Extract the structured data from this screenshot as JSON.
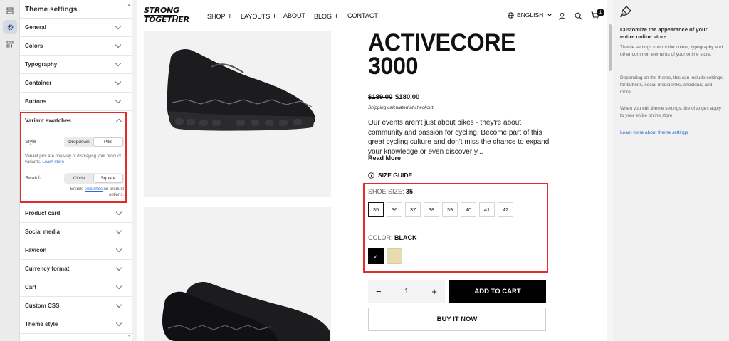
{
  "panel": {
    "title": "Theme settings",
    "sections_top": [
      {
        "label": "General"
      },
      {
        "label": "Colors"
      },
      {
        "label": "Typography"
      },
      {
        "label": "Container"
      },
      {
        "label": "Buttons"
      }
    ],
    "variant_swatches": {
      "label": "Variant swatches",
      "style_label": "Style",
      "style_options": [
        "Dropdown",
        "Pills"
      ],
      "style_selected": "Pills",
      "help_text": "Variant pills are one way of displaying your product variants.",
      "help_link": "Learn more",
      "swatch_label": "Swatch",
      "swatch_options": [
        "Circle",
        "Square"
      ],
      "swatch_selected": "Square",
      "note_prefix": "Enable",
      "note_link": "swatches",
      "note_suffix": "on product options."
    },
    "sections_bottom": [
      {
        "label": "Product card"
      },
      {
        "label": "Social media"
      },
      {
        "label": "Favicon"
      },
      {
        "label": "Currency format"
      },
      {
        "label": "Cart"
      },
      {
        "label": "Custom CSS"
      },
      {
        "label": "Theme style"
      }
    ]
  },
  "store": {
    "logo_line1": "STRONG",
    "logo_line2": "TOGETHER",
    "menu": [
      {
        "label": "SHOP",
        "has_plus": true
      },
      {
        "label": "LAYOUTS",
        "has_plus": true
      },
      {
        "label": "ABOUT",
        "has_plus": false
      },
      {
        "label": "BLOG",
        "has_plus": true
      },
      {
        "label": "CONTACT",
        "has_plus": false
      }
    ],
    "language": "ENGLISH",
    "cart_count": "1",
    "product": {
      "title_line1": "ACTIVECORE",
      "title_line2": "3000",
      "price_old": "$189.00",
      "price_new": "$180.00",
      "shipping_link": "Shipping",
      "shipping_text": "calculated at checkout.",
      "description": "Our events aren't just about bikes - they're about community and passion for cycling. Become part of this great cycling culture and don't miss the chance to expand your knowledge or even discover y...",
      "read_more": "Read More",
      "size_guide": "SIZE GUIDE",
      "size_label": "SHOE SIZE:",
      "size_selected": "35",
      "sizes": [
        "35",
        "36",
        "37",
        "38",
        "39",
        "40",
        "41",
        "42"
      ],
      "color_label": "COLOR:",
      "color_selected": "BLACK",
      "swatches": [
        {
          "name": "Black",
          "color": "#000000",
          "selected": true
        },
        {
          "name": "Beige",
          "color": "#e8dcae",
          "selected": false
        }
      ],
      "quantity": "1",
      "add_to_cart": "ADD TO CART",
      "buy_now": "BUY IT NOW"
    }
  },
  "info": {
    "heading": "Customize the appearance of your entire online store",
    "p1": "Theme settings control the colors, typography and other common elements of your online store.",
    "p2": "Depending on the theme, this can include settings for buttons, social media links, checkout, and more.",
    "p3": "When you edit theme settings, the changes apply to your entire online store.",
    "link": "Learn more about theme settings"
  },
  "colors": {
    "highlight": "#e22b2b",
    "link": "#2c6ecb"
  }
}
